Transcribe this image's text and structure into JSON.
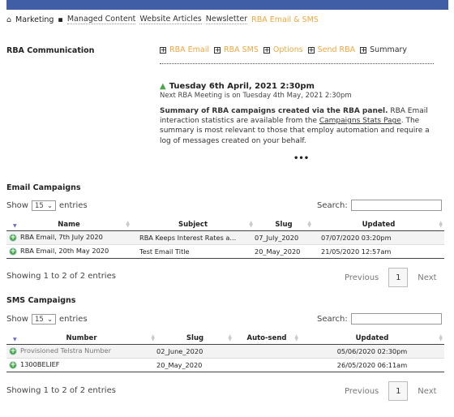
{
  "breadcrumb": {
    "items": [
      "Marketing",
      "Managed Content",
      "Website Articles",
      "Newsletter"
    ],
    "current": "RBA Email & SMS"
  },
  "section_title": "RBA Communication",
  "tabs": [
    {
      "label": "RBA Email"
    },
    {
      "label": "RBA SMS"
    },
    {
      "label": "Options"
    },
    {
      "label": "Send RBA"
    },
    {
      "label": "Summary",
      "active": true
    }
  ],
  "summary": {
    "date": "Tuesday 6th April, 2021 2:30pm",
    "next_meeting": "Next RBA Meeting is on Tuesday 4th May, 2021 2:30pm",
    "bold": "Summary of RBA campaigns created via the RBA panel.",
    "text1": " RBA Email interaction statistics are available from the ",
    "link": "Campaigns Stats Page",
    "text2": ". The summary is most relevant to those that employ automation and require a log of messages created on your behalf.",
    "more": "•••"
  },
  "email": {
    "title": "Email Campaigns",
    "show": "Show",
    "entries_value": "15",
    "entries": "entries",
    "search": "Search:",
    "columns": [
      "Name",
      "Subject",
      "Slug",
      "Updated"
    ],
    "rows": [
      [
        "RBA Email, 7th July 2020",
        "RBA Keeps Interest Rates a...",
        "07_July_2020",
        "07/07/2020 03:20pm"
      ],
      [
        "RBA Email, 20th May 2020",
        "Test Email Title",
        "20_May_2020",
        "21/05/2020 12:57am"
      ]
    ],
    "info": "Showing 1 to 2 of 2 entries",
    "prev": "Previous",
    "page": "1",
    "next": "Next"
  },
  "sms": {
    "title": "SMS Campaigns",
    "show": "Show",
    "entries_value": "15",
    "entries": "entries",
    "search": "Search:",
    "columns": [
      "Number",
      "Slug",
      "Auto-send",
      "Updated"
    ],
    "rows": [
      [
        "Provisioned Telstra Number",
        "02_June_2020",
        "",
        "05/06/2020 02:30pm"
      ],
      [
        "1300BELIEF",
        "20_May_2020",
        "",
        "26/05/2020 06:11am"
      ]
    ],
    "info": "Showing 1 to 2 of 2 entries",
    "prev": "Previous",
    "page": "1",
    "next": "Next"
  },
  "colors": {
    "nav": "#3f5ea6",
    "accent": "#f0a640",
    "add": "#4aa84a"
  }
}
